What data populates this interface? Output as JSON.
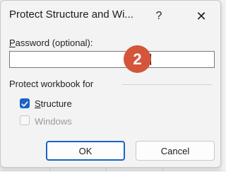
{
  "dialog": {
    "title": "Protect Structure and Wi...",
    "help_glyph": "?",
    "close_glyph": "✕"
  },
  "password": {
    "label_mnemonic": "P",
    "label_rest": "assword (optional):",
    "value": ""
  },
  "step_badge": "2",
  "protect_group": {
    "label": "Protect workbook for",
    "structure": {
      "mnemonic": "S",
      "rest": "tructure",
      "checked": true
    },
    "windows": {
      "label": "Windows",
      "checked": false,
      "enabled": false
    }
  },
  "buttons": {
    "ok": "OK",
    "cancel": "Cancel"
  },
  "colors": {
    "accent": "#1a63c7",
    "badge": "#d4553a"
  }
}
